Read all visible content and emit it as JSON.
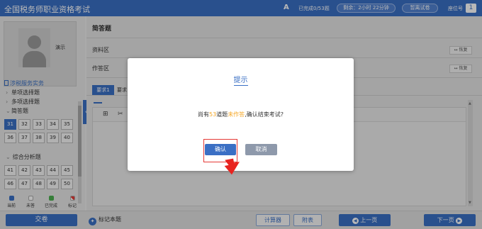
{
  "app": {
    "title": "全国税务师职业资格考试",
    "font_size_icon": "A",
    "progress_text": "已完成0/53题",
    "timer_text": "剩余：2小时 22分钟",
    "calculator_label": "暂离试卷",
    "seat_label": "座位号",
    "seat_number": "1"
  },
  "candidate": {
    "name": "演示"
  },
  "sidebar": {
    "subject": "涉税服务实务",
    "categories": [
      {
        "label": "单项选择题"
      },
      {
        "label": "多项选择题"
      },
      {
        "label": "简答题"
      }
    ],
    "short_answer_numbers": [
      "31",
      "32",
      "33",
      "34",
      "35",
      "36",
      "37",
      "38",
      "39",
      "40"
    ],
    "analysis_title": "综合分析题",
    "analysis_numbers": [
      "41",
      "42",
      "43",
      "44",
      "45",
      "46",
      "47",
      "48",
      "49",
      "50"
    ],
    "legend": {
      "current": "当前",
      "unanswered": "未答",
      "done": "已完成",
      "marked": "标记"
    }
  },
  "main": {
    "question_type": "简答题",
    "material_label": "资料区",
    "answer_label": "作答区",
    "restore_label": "↔ 恢复",
    "tab1": "要求1",
    "tab2": "要求"
  },
  "bottom": {
    "submit": "交卷",
    "mark_question": "标记本题",
    "calculator": "计算器",
    "attachment": "附表",
    "prev": "上一页",
    "next": "下一页"
  },
  "modal": {
    "title": "提示",
    "message_prefix": "尚有",
    "count": "53",
    "message_mid": "道题",
    "unanswered": "未作答",
    "message_suffix": ",确认结束考试?",
    "ok": "确认",
    "cancel": "取消"
  },
  "colors": {
    "accent": "#3a6fc4",
    "highlight": "#f5a623",
    "warning": "#e53935"
  }
}
